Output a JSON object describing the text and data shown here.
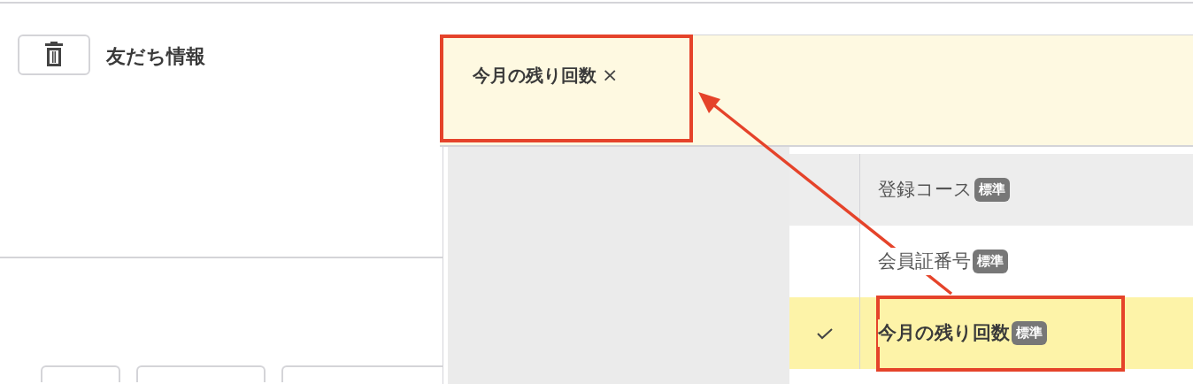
{
  "section": {
    "title": "友だち情報",
    "delete_button": {
      "kind": "trash"
    }
  },
  "selected_field": {
    "tags": [
      {
        "label": "今月の残り回数",
        "remove": "×"
      }
    ]
  },
  "dropdown": {
    "options": [
      {
        "label": "登録コース",
        "badge": "標準",
        "selected": false,
        "hovered": true
      },
      {
        "label": "会員証番号",
        "badge": "標準",
        "selected": false,
        "hovered": false
      },
      {
        "label": "今月の残り回数",
        "badge": "標準",
        "selected": true,
        "hovered": false
      }
    ]
  }
}
